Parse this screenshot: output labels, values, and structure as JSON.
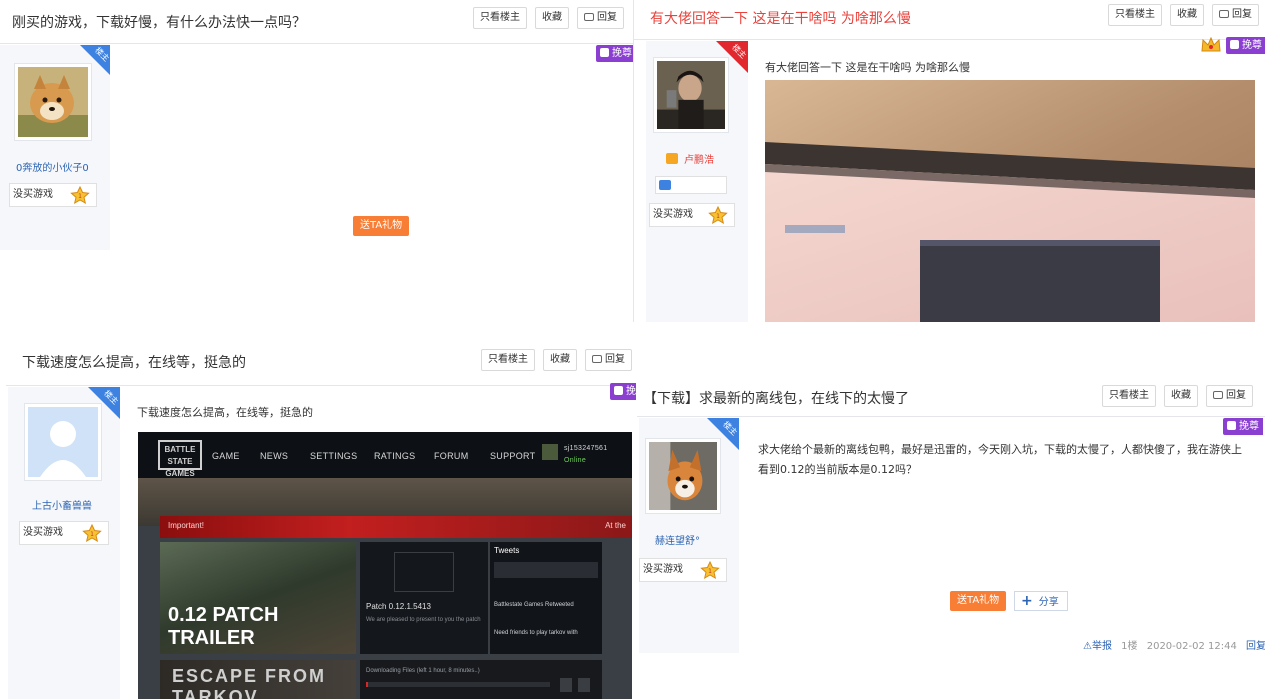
{
  "common": {
    "btn_only_op": "只看楼主",
    "btn_collect": "收藏",
    "btn_reply": "回复",
    "op_tag": "楼主",
    "change_tag": "挽尊",
    "no_game_badge": "没买游戏",
    "gift_label": "送TA礼物",
    "share_label": "分享"
  },
  "thread1": {
    "title": "刚买的游戏，下载好慢，有什么办法快一点吗？",
    "username": "0奔放的小伙子0"
  },
  "thread2": {
    "title": "有大佬回答一下 这是在干啥吗 为啥那么慢",
    "username": "卢鹏浩",
    "body": "有大佬回答一下 这是在干啥吗 为啥那么慢"
  },
  "thread3": {
    "title": "下载速度怎么提高，在线等，挺急的",
    "username": "上古小畜兽兽",
    "body": "下载速度怎么提高，在线等，挺急的",
    "game_screenshot": {
      "logo": "BATTLE STATE GAMES",
      "nav": [
        "GAME",
        "NEWS",
        "SETTINGS",
        "RATINGS",
        "FORUM",
        "SUPPORT"
      ],
      "user": "sj153247561",
      "status": "Online",
      "banner_left": "Important!",
      "banner_right": "At the",
      "video_title": "0.12 PATCH TRAILER",
      "patch_title": "Patch 0.12.1.5413",
      "patch_desc": "We are pleased to present to you the patch",
      "tweets_title": "Tweets",
      "tweet_author": "Battlestate Games Retweeted",
      "tweet_text": "Need friends to play tarkov with",
      "bottom_logo": "ESCAPE FROM TARKOV",
      "downloading": "Downloading Files (left 1 hour, 8 minutes..)"
    }
  },
  "thread4": {
    "title": "【下载】求最新的离线包，在线下的太慢了",
    "username": "赫连望舒°",
    "body": "求大佬给个最新的离线包鸭，最好是迅雷的，今天刚入坑，下载的太慢了，人都快傻了，我在游侠上看到0.12的当前版本是0.12吗？",
    "report": "举报",
    "floor": "1楼",
    "timestamp": "2020-02-02 12:44",
    "reply": "回复"
  }
}
